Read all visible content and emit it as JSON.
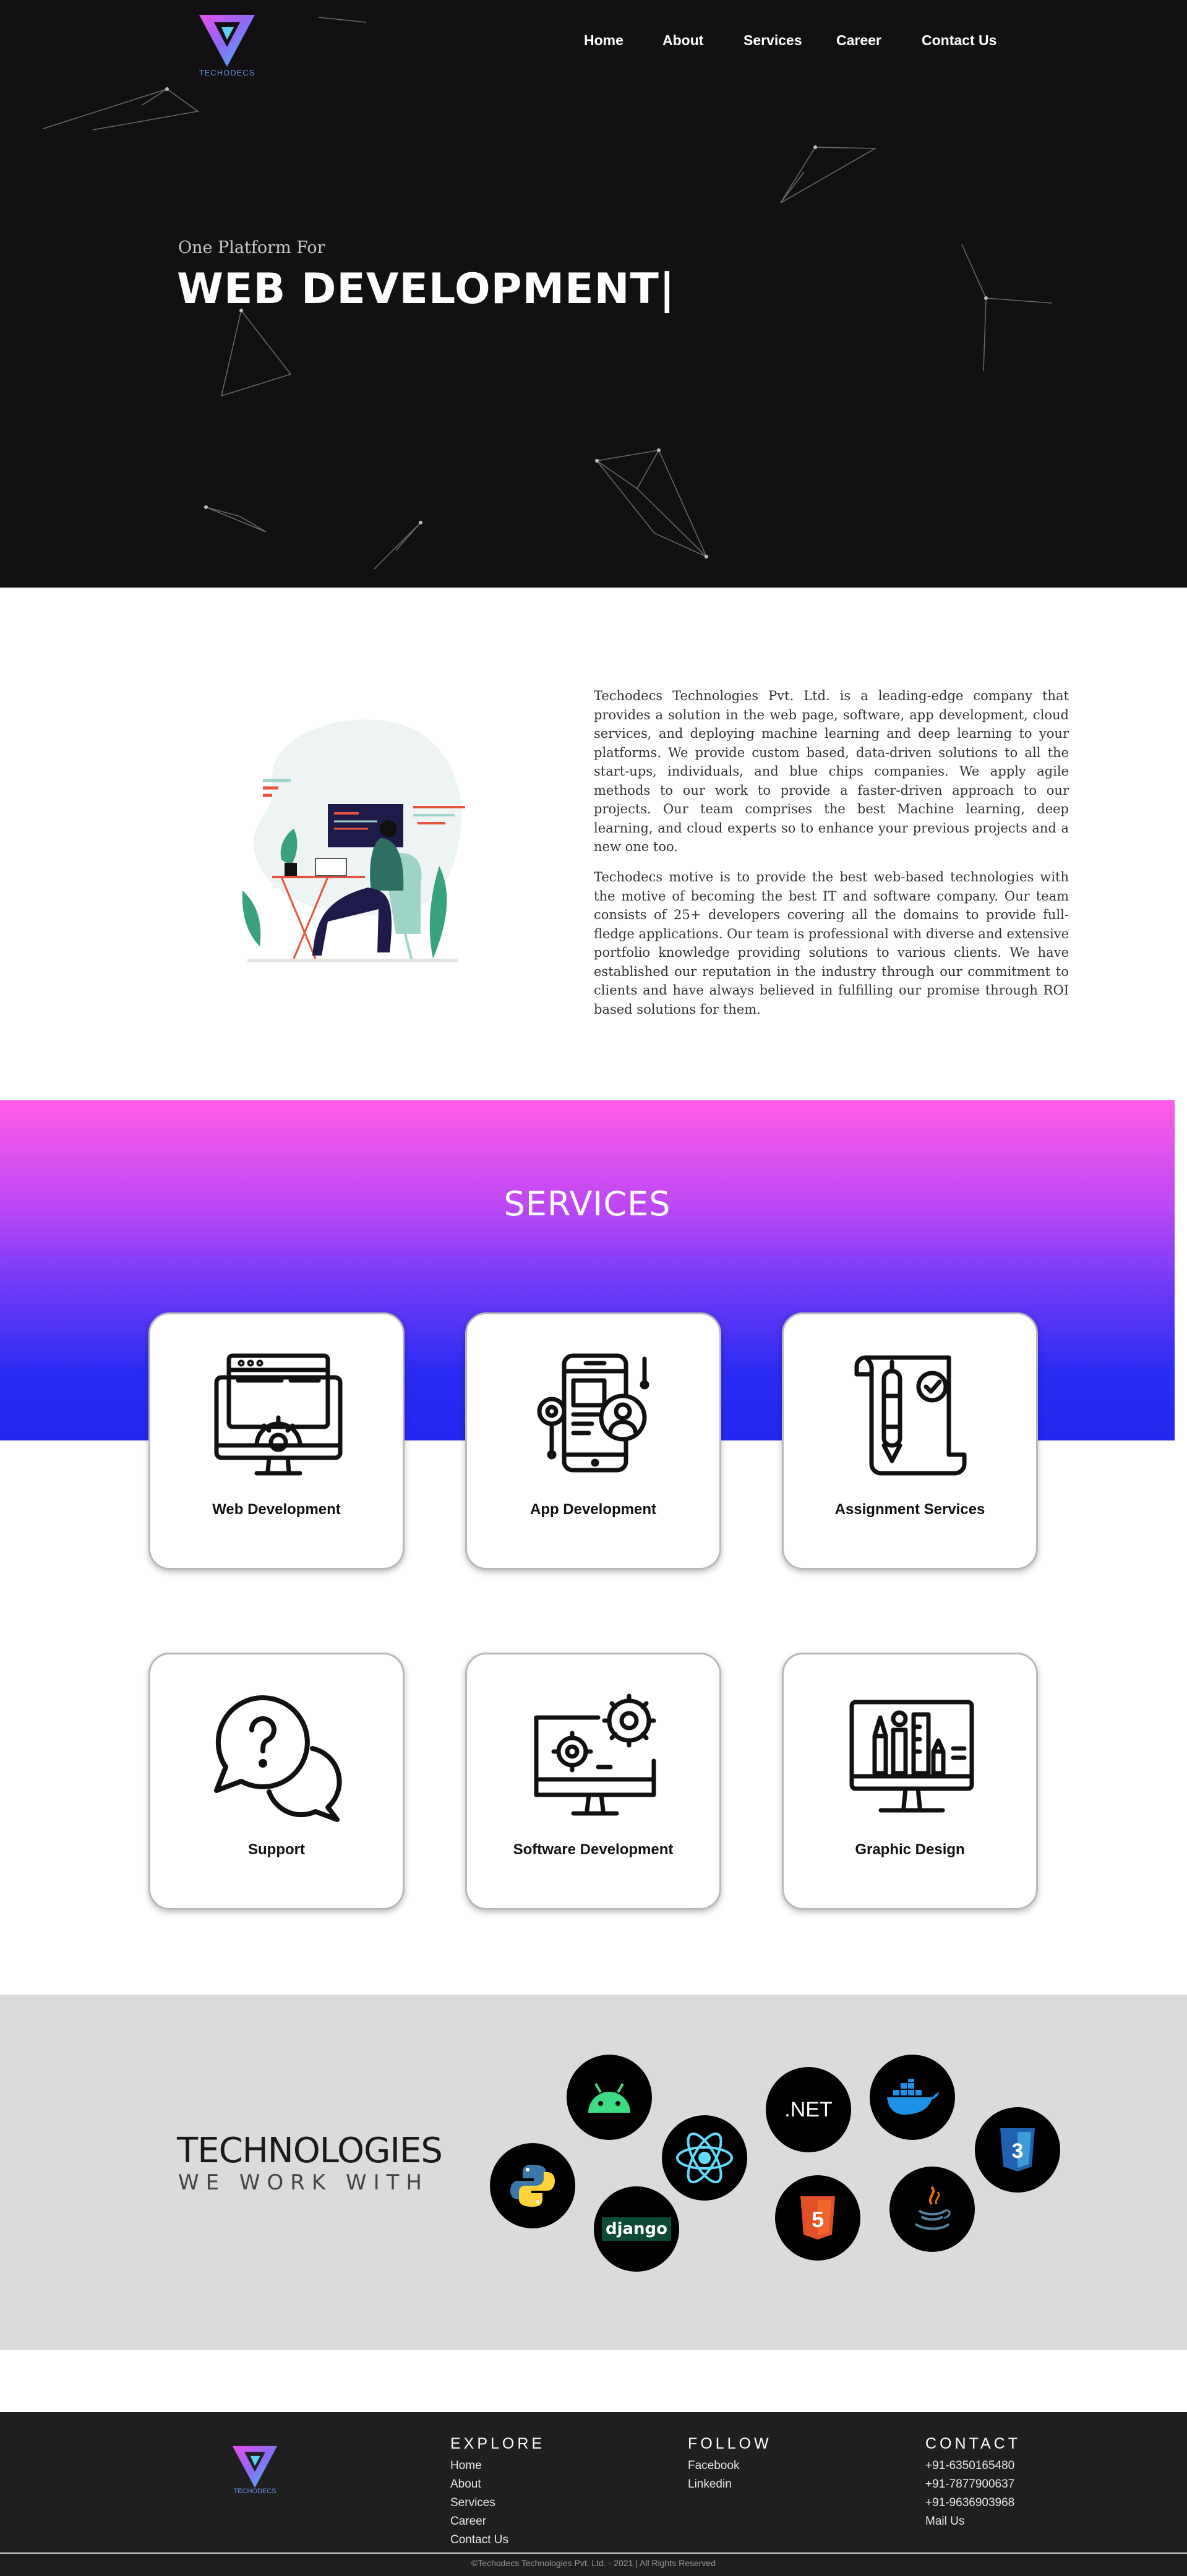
{
  "header": {
    "logo_text": "TECHODECS",
    "nav": [
      "Home",
      "About",
      "Services",
      "Career",
      "Contact Us"
    ]
  },
  "hero": {
    "subtitle": "One Platform For",
    "title": "WEB DEVELOPMENT|"
  },
  "about": {
    "paragraph1": "Techodecs Technologies Pvt. Ltd. is a leading-edge company that provides a solution in the web page, software, app development, cloud services, and deploying machine learning and deep learning to your platforms. We provide custom based, data-driven solutions to all the start-ups, individuals, and blue chips companies. We apply agile methods to our work to provide a faster-driven approach to our projects. Our team comprises the best Machine learning, deep learning, and cloud experts so to enhance your previous projects and a new one too.",
    "paragraph2": "Techodecs motive is to provide the best web-based technologies with the motive of becoming the best IT and software company. Our team consists of 25+ developers covering all the domains to provide full-fledge applications. Our team is professional with diverse and extensive portfolio knowledge providing solutions to various clients. We have established our reputation in the industry through our commitment to clients and have always believed in fulfilling our promise through ROI based solutions for them."
  },
  "services": {
    "heading": "SERVICES",
    "items": [
      {
        "label": "Web Development",
        "icon": "web-development-icon"
      },
      {
        "label": "App Development",
        "icon": "app-development-icon"
      },
      {
        "label": "Assignment Services",
        "icon": "assignment-icon"
      },
      {
        "label": "Support",
        "icon": "support-chat-icon"
      },
      {
        "label": "Software Development",
        "icon": "software-development-icon"
      },
      {
        "label": "Graphic Design",
        "icon": "graphic-design-icon"
      }
    ]
  },
  "technologies": {
    "title": "TECHNOLOGIES",
    "subtitle": "WE WORK WITH",
    "items": [
      {
        "name": "android",
        "icon": "android-icon"
      },
      {
        "name": "react",
        "icon": "react-icon"
      },
      {
        "name": ".NET",
        "icon": "dotnet-icon"
      },
      {
        "name": "docker",
        "icon": "docker-icon"
      },
      {
        "name": "css3",
        "icon": "css3-icon"
      },
      {
        "name": "python",
        "icon": "python-icon"
      },
      {
        "name": "django",
        "icon": "django-icon"
      },
      {
        "name": "html5",
        "icon": "html5-icon"
      },
      {
        "name": "java",
        "icon": "java-icon"
      }
    ]
  },
  "footer": {
    "logo_text": "TECHODECS",
    "explore": {
      "heading": "EXPLORE",
      "links": [
        "Home",
        "About",
        "Services",
        "Career",
        "Contact Us"
      ]
    },
    "follow": {
      "heading": "FOLLOW",
      "links": [
        "Facebook",
        "Linkedin"
      ]
    },
    "contact": {
      "heading": "CONTACT",
      "links": [
        "+91-6350165480",
        "+91-7877900637",
        "+91-9636903968",
        "Mail Us"
      ]
    },
    "copyright": "©Techodecs Technologies Pvt. Ltd. - 2021 | All Rights Reserved"
  },
  "colors": {
    "hero_bg": "#121013",
    "services_gradient_top": "#ff5ce8",
    "services_gradient_bottom": "#2328f0",
    "tech_bg": "#dcdadd",
    "footer_bg": "#1f1e21"
  }
}
